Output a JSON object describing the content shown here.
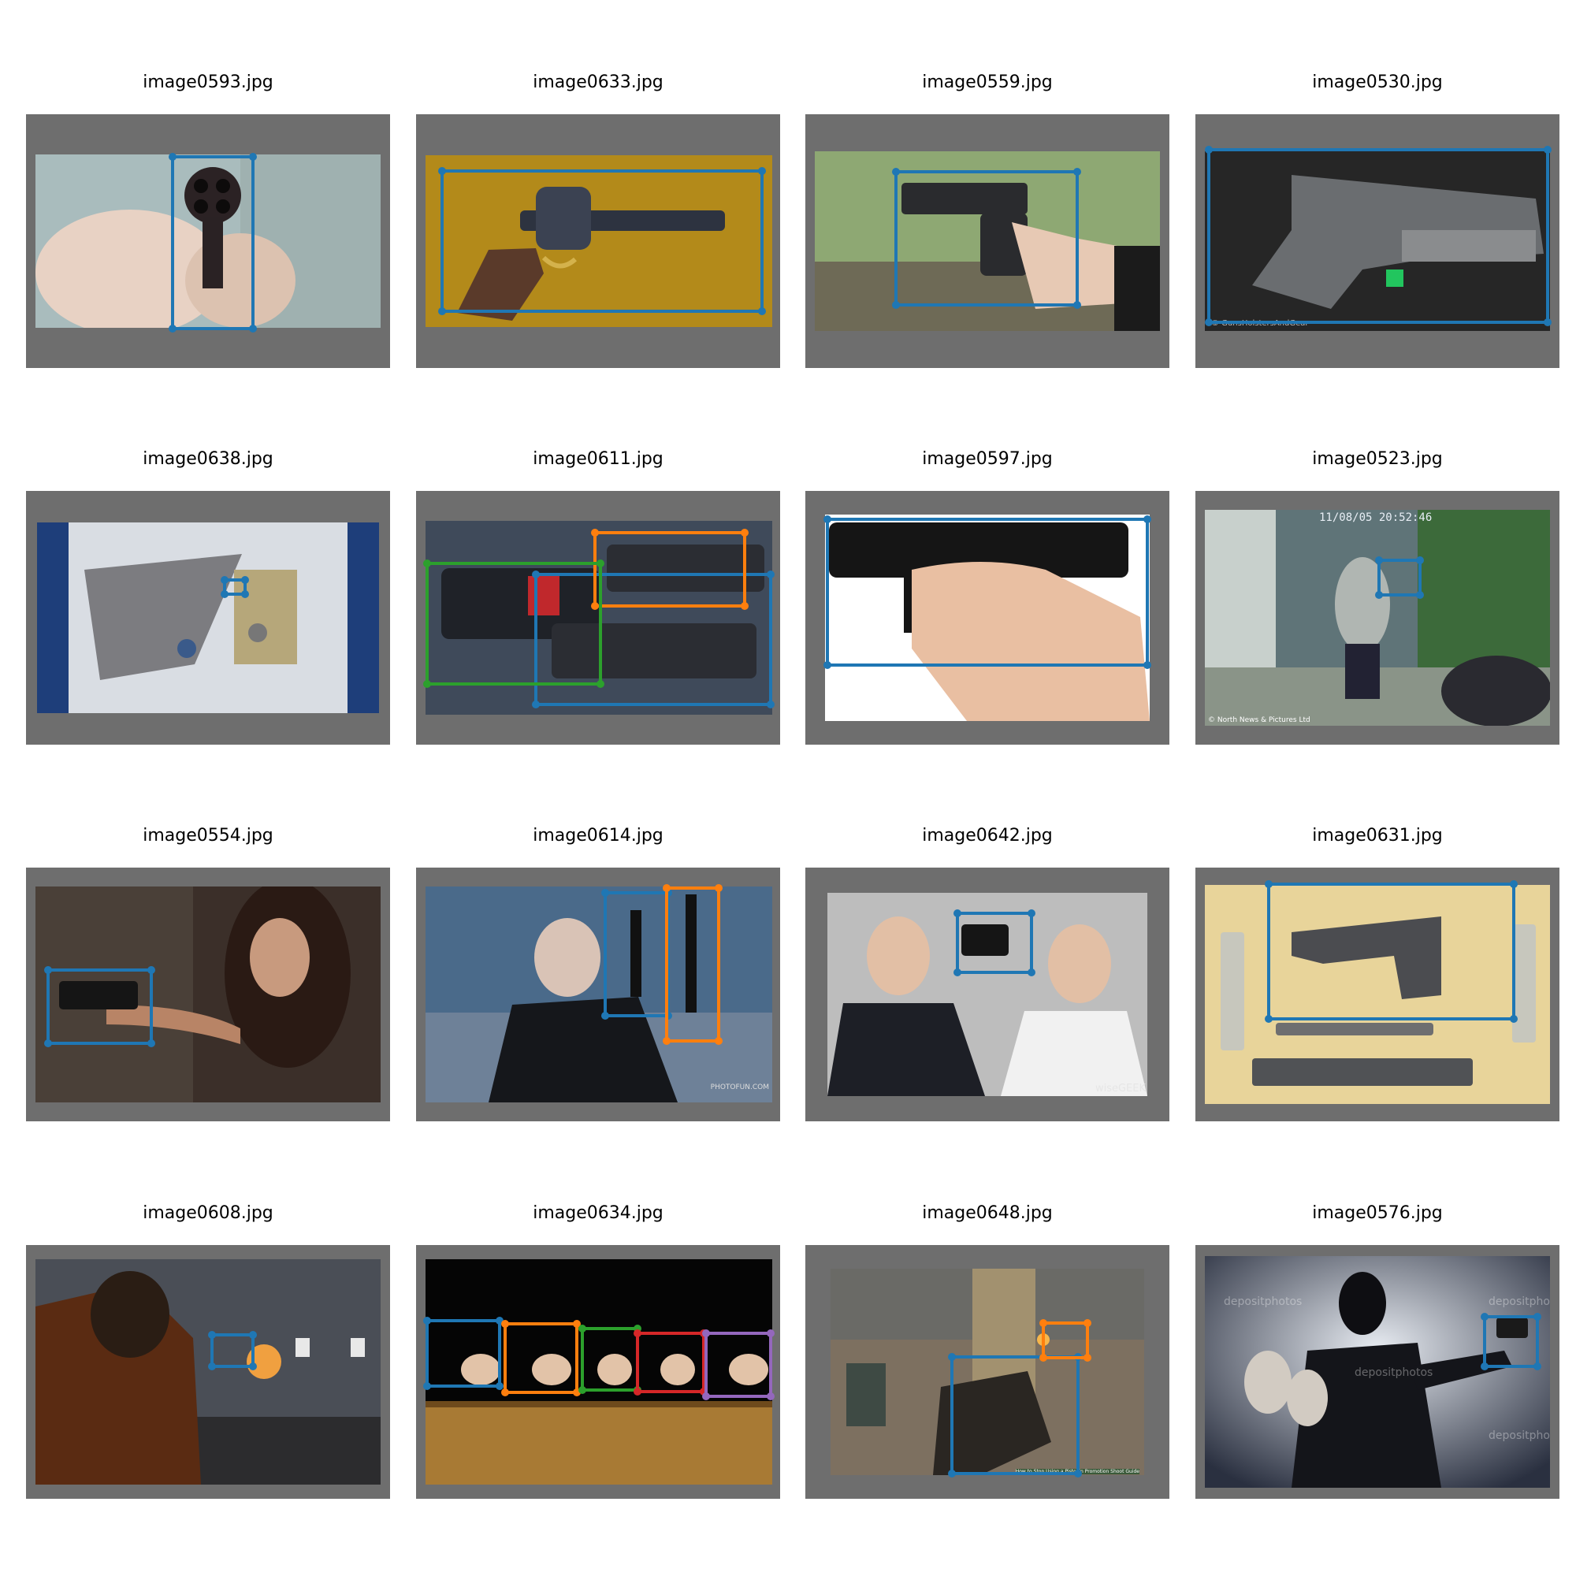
{
  "figure": {
    "panels": [
      {
        "title": "image0593.jpg",
        "scene": "revolver aimed at viewer",
        "bg": "#b8c7c4",
        "boxes": [
          {
            "color": "#1f77b4"
          }
        ]
      },
      {
        "title": "image0633.jpg",
        "scene": "revolver on mustard cloth",
        "bg": "#b8860b",
        "boxes": [
          {
            "color": "#1f77b4"
          }
        ]
      },
      {
        "title": "image0559.jpg",
        "scene": "hand holding pistol",
        "bg": "#8fae6a",
        "boxes": [
          {
            "color": "#1f77b4"
          }
        ]
      },
      {
        "title": "image0530.jpg",
        "scene": "pistol on dark background",
        "bg": "#2b2b2b",
        "caption": "© GunsHolstersAndGear",
        "boxes": [
          {
            "color": "#1f77b4"
          }
        ]
      },
      {
        "title": "image0638.jpg",
        "scene": "store security camera",
        "bg": "#d9dde3",
        "boxes": [
          {
            "color": "#1f77b4"
          }
        ]
      },
      {
        "title": "image0611.jpg",
        "scene": "pistols in display case",
        "bg": "#4a5566",
        "boxes": [
          {
            "color": "#1f77b4"
          },
          {
            "color": "#ff7f0e"
          },
          {
            "color": "#2ca02c"
          }
        ]
      },
      {
        "title": "image0597.jpg",
        "scene": "hand holding black pistol",
        "bg": "#ffffff",
        "boxes": [
          {
            "color": "#1f77b4"
          }
        ]
      },
      {
        "title": "image0523.jpg",
        "scene": "cctv robbery in shop",
        "bg": "#7a8a84",
        "timestamp": "11/08/05 20:52:46",
        "caption": "© North News & Pictures Ltd",
        "boxes": [
          {
            "color": "#1f77b4"
          }
        ]
      },
      {
        "title": "image0554.jpg",
        "scene": "woman aiming pistol",
        "bg": "#3d2e26",
        "boxes": [
          {
            "color": "#1f77b4"
          }
        ]
      },
      {
        "title": "image0614.jpg",
        "scene": "bald man with silenced pistols",
        "bg": "#3c5a78",
        "caption": "PHOTOFUN.COM",
        "boxes": [
          {
            "color": "#1f77b4"
          },
          {
            "color": "#ff7f0e"
          }
        ]
      },
      {
        "title": "image0642.jpg",
        "scene": "two men in suits with pistol",
        "bg": "#c9c9c9",
        "caption": "wiseGEEK",
        "boxes": [
          {
            "color": "#1f77b4"
          }
        ]
      },
      {
        "title": "image0631.jpg",
        "scene": "disassembled pistol parts",
        "bg": "#e8d59a",
        "boxes": [
          {
            "color": "#1f77b4"
          }
        ]
      },
      {
        "title": "image0608.jpg",
        "scene": "shooter at firing range",
        "bg": "#3a3a3a",
        "boxes": [
          {
            "color": "#1f77b4"
          }
        ]
      },
      {
        "title": "image0634.jpg",
        "scene": "row of pistols in hands",
        "bg": "#050505",
        "boxes": [
          {
            "color": "#1f77b4"
          },
          {
            "color": "#ff7f0e"
          },
          {
            "color": "#2ca02c"
          },
          {
            "color": "#d62728"
          },
          {
            "color": "#9467bd"
          }
        ]
      },
      {
        "title": "image0648.jpg",
        "scene": "video game first person pistol",
        "bg": "#8a7a66",
        "caption": "How to Stop Using a Pistol in Promotion Shoot Guide",
        "boxes": [
          {
            "color": "#1f77b4"
          },
          {
            "color": "#ff7f0e"
          }
        ]
      },
      {
        "title": "image0576.jpg",
        "scene": "masked robber with money bags",
        "bg": "#1c2030",
        "watermark": "depositphotos",
        "boxes": [
          {
            "color": "#1f77b4"
          }
        ]
      }
    ]
  }
}
